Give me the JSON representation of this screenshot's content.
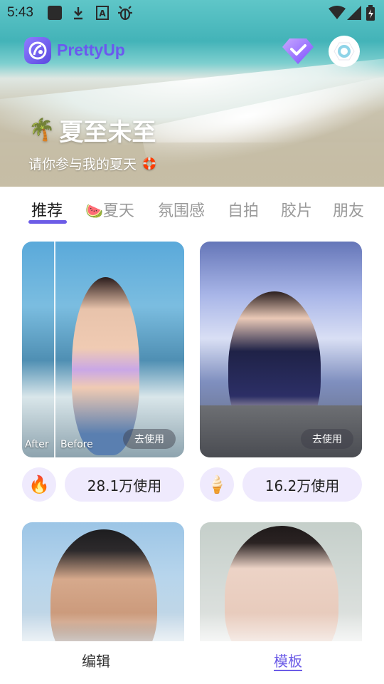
{
  "status_bar": {
    "time": "5:43",
    "left_icons": [
      "app-square-icon",
      "download-icon",
      "text-a-icon",
      "bug-icon"
    ],
    "right_icons": [
      "wifi-icon",
      "signal-icon",
      "battery-icon"
    ]
  },
  "header": {
    "brand": "PrettyUp",
    "logo_icon": "prettyup-logo-icon",
    "vip_icon": "vip-diamond-icon",
    "settings_icon": "settings-hexagon-icon",
    "accent_color": "#6c5ce7"
  },
  "hero": {
    "title_emoji": "🌴",
    "title": "夏至未至",
    "subtitle": "请你参与我的夏天",
    "subtitle_emoji": "🛟"
  },
  "tabs": [
    {
      "label": "推荐",
      "emoji": "",
      "active": true
    },
    {
      "label": "夏天",
      "emoji": "🍉",
      "active": false
    },
    {
      "label": "氛围感",
      "emoji": "",
      "active": false
    },
    {
      "label": "自拍",
      "emoji": "",
      "active": false
    },
    {
      "label": "胶片",
      "emoji": "",
      "active": false
    },
    {
      "label": "朋友",
      "emoji": "",
      "active": false
    }
  ],
  "cards": [
    {
      "after_label": "After",
      "before_label": "Before",
      "use_label": "去使用",
      "badge_emoji": "🔥",
      "usage": "28.1万使用"
    },
    {
      "use_label": "去使用",
      "badge_emoji": "🍦",
      "usage": "16.2万使用"
    },
    {},
    {}
  ],
  "bottom_nav": [
    {
      "label": "编辑",
      "active": false
    },
    {
      "label": "模板",
      "active": true
    }
  ]
}
